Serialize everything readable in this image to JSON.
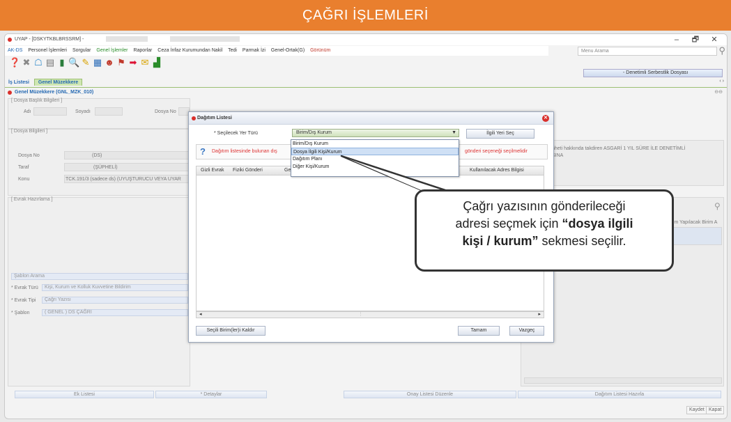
{
  "banner": "ÇAĞRI İŞLEMLERİ",
  "window": {
    "title": "UYAP - [DSKYTKBLBRSSRM] -",
    "minimize": "–",
    "maximize": "🗗",
    "close": "✕"
  },
  "menu": [
    "AK-DS",
    "Personel İşlemleri",
    "Sorgular",
    "Genel İşlemler",
    "Raporlar",
    "Ceza İnfaz Kurumundan Nakil",
    "Tedi",
    "Parmak İzi",
    "Genel-Ortak(G)",
    "Görünüm"
  ],
  "menu_search_placeholder": "Menu Arama",
  "dosya_select": "- Denetimli Serbestlik Dosyası",
  "tabs": [
    "İş Listesi",
    "Genel Müzekkere"
  ],
  "tab_nav": "‹ ›",
  "form_title": "Genel Müzekkere (GNL_MZK_010)",
  "form_ctl": "⊖⊖",
  "dosya_baslik": {
    "legend": "[ Dosya Başlık Bilgileri ]",
    "adi": "Adı",
    "soyadi": "Soyadı",
    "dosya_no": "Dosya No"
  },
  "dosya_bilgileri": {
    "legend": "[ Dosya Bilgileri ]",
    "dosya_no_label": "Dosya No",
    "dosya_no": "(DS)",
    "taraf_label": "Taraf",
    "taraf": "(ŞÜPHELİ)",
    "konu_label": "Konu",
    "konu": "TCK.191/3 (sadece ds) (UYUŞTURUCU VEYA UYAR",
    "right_text": "nheti hakkında takdiren ASGARİ 1 YIL SÜRE İLE DENETİMLİ",
    "right_text2": "SINA"
  },
  "evrak": {
    "legend": "[ Evrak Hazırlama ]",
    "sablon_arama": "Şablon Arama",
    "evrak_turu_label": "* Evrak Türü",
    "evrak_turu": "Kişi, Kurum ve Kolluk Kuvvetine Bildirim",
    "evrak_tipi_label": "* Evrak Tipi",
    "evrak_tipi": "Çağrı Yazısı",
    "sablon_label": "* Şablon",
    "sablon": "( GENEL ) DS ÇAĞRI",
    "right_col": "lem Yapılacak Birim A"
  },
  "bottom_buttons": [
    "Ek Listesi",
    "* Detaylar",
    "Onay Listesi Düzenle",
    "Dağıtım Listesi Hazırla"
  ],
  "save_buttons": [
    "Kaydet",
    "Kapat"
  ],
  "dialog": {
    "title": "Dağıtım Listesi",
    "close": "✕",
    "secilecek_label": "* Seçilecek Yer Türü",
    "combo_value": "Birim/Dış Kurum",
    "ilgili_button": "İlgili Yeri Seç",
    "info_text": "Dağıtım listesinde bulunan dış",
    "info_tail": "gönderi seçeneği seçilmelidir",
    "columns": [
      "Gizli Evrak",
      "Fiziki Gönderi",
      "Ge",
      "Kullanılacak Adres Bilgisi"
    ],
    "options": [
      "Birim/Dış Kurum",
      "Dosya İlgili Kişi/Kurum",
      "Dağıtım Planı",
      "Diğer Kişi/Kurum"
    ],
    "highlighted_option": "Dosya İlgili Kişi/Kurum",
    "remove_button": "Seçili Birim(ler)i Kaldır",
    "ok_button": "Tamam",
    "cancel_button": "Vazgeç"
  },
  "callout": {
    "line1": "Çağrı yazısının gönderileceği",
    "line2a": "adresi seçmek için ",
    "line2b": "“dosya ilgili",
    "line3a": "kişi / kurum”",
    "line3b": " sekmesi seçilir."
  },
  "colors": {
    "banner": "#e97f2e",
    "tab_active": "#cfe7b2",
    "dialog_highlight": "#cfe0f5",
    "alert_text": "#dd3333"
  }
}
